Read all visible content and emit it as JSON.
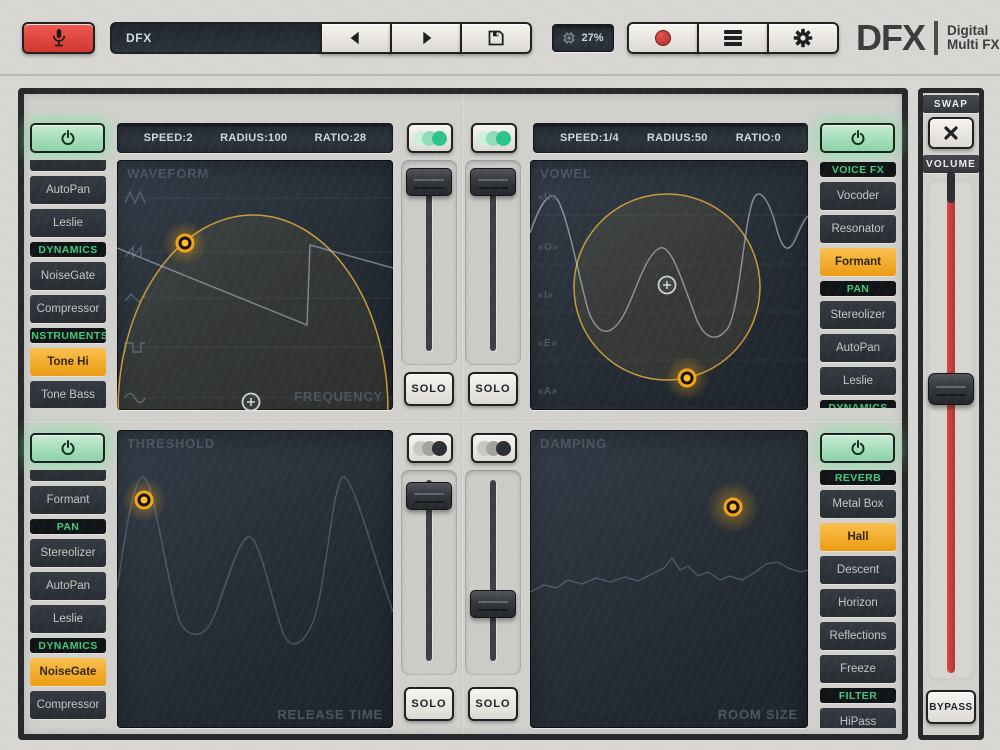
{
  "toolbar": {
    "preset_name": "DFX",
    "cpu_value": "27%",
    "brand": "DFX",
    "tagline_line1": "Digital",
    "tagline_line2": "Multi FX"
  },
  "labels": {
    "solo": "SOLO",
    "swap": "SWAP",
    "volume": "VOLUME",
    "bypass": "BYPASS"
  },
  "colors": {
    "accent_orange": "#f2a51a",
    "accent_green": "#2dc48c",
    "power_green": "#8bd2a7",
    "record_red": "#c5322d",
    "volume_red": "#c4403b",
    "category_green": "#43c979"
  },
  "quadrants": {
    "q1": {
      "status": [
        "SPEED:2",
        "RADIUS:100",
        "RATIO:28"
      ],
      "screen_title": "WAVEFORM",
      "corner_label": "FREQUENCY",
      "toggles": [
        "on",
        "on"
      ],
      "list": [
        "AutoPan",
        "Leslie",
        "DYNAMICS",
        "NoiseGate",
        "Compressor",
        "INSTRUMENTS",
        "Tone Hi",
        "Tone Bass"
      ],
      "selected": "Tone Hi",
      "power": "on"
    },
    "q2": {
      "status": [
        "SPEED:1/4",
        "RADIUS:50",
        "RATIO:0"
      ],
      "screen_title": "VOWEL",
      "vowels": [
        "«U»",
        "«O»",
        "«I»",
        "«E»",
        "«A»"
      ],
      "list": [
        "VOICE FX",
        "Vocoder",
        "Resonator",
        "Formant",
        "PAN",
        "Stereolizer",
        "AutoPan",
        "Leslie",
        "DYNAMICS"
      ],
      "selected": "Formant",
      "power": "on"
    },
    "q3": {
      "screen_title": "THRESHOLD",
      "corner_label": "RELEASE TIME",
      "toggles": [
        "off",
        "off"
      ],
      "list": [
        "Formant",
        "PAN",
        "Stereolizer",
        "AutoPan",
        "Leslie",
        "DYNAMICS",
        "NoiseGate",
        "Compressor"
      ],
      "selected": "NoiseGate",
      "power": "on"
    },
    "q4": {
      "screen_title": "DAMPING",
      "corner_label": "ROOM SIZE",
      "list": [
        "REVERB",
        "Metal Box",
        "Hall",
        "Descent",
        "Horizon",
        "Reflections",
        "Freeze",
        "FILTER",
        "HiPass"
      ],
      "selected": "Hall",
      "power": "on"
    }
  }
}
